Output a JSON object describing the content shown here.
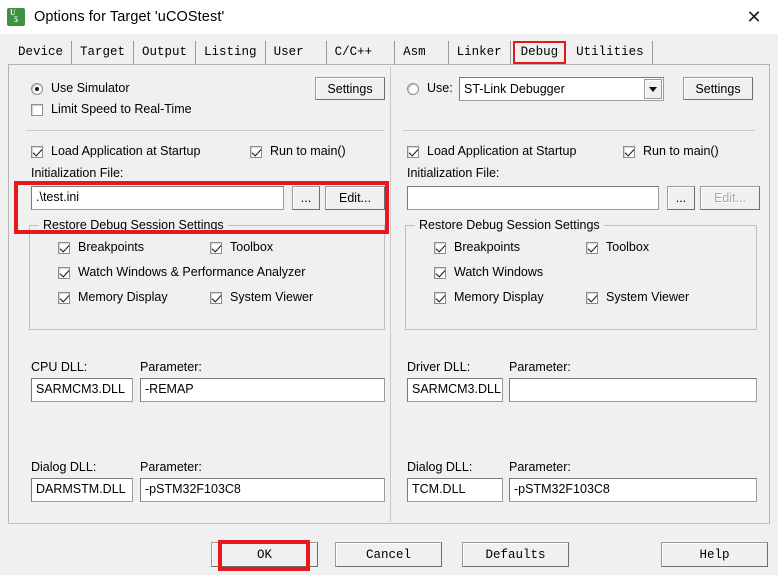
{
  "window": {
    "title": "Options for Target 'uCOStest'",
    "icon": "uvision-logo-icon",
    "icon_glyph_top": "U",
    "icon_glyph_bottom": "5",
    "close_label": "✕"
  },
  "tabs": [
    {
      "label": "Device",
      "active": false
    },
    {
      "label": "Target",
      "active": false
    },
    {
      "label": "Output",
      "active": false
    },
    {
      "label": "Listing",
      "active": false
    },
    {
      "label": "User",
      "active": false
    },
    {
      "label": "C/C++",
      "active": false
    },
    {
      "label": "Asm",
      "active": false
    },
    {
      "label": "Linker",
      "active": false
    },
    {
      "label": "Debug",
      "active": true
    },
    {
      "label": "Utilities",
      "active": false
    }
  ],
  "left_pane": {
    "use_simulator_label": "Use Simulator",
    "use_simulator_checked": true,
    "limit_speed_label": "Limit Speed to Real-Time",
    "limit_speed_checked": false,
    "settings_label": "Settings",
    "load_app_label": "Load Application at Startup",
    "load_app_checked": true,
    "run_to_main_label": "Run to main()",
    "run_to_main_checked": true,
    "init_file_label": "Initialization File:",
    "init_file_value": ".\\test.ini",
    "browse_label": "...",
    "edit_label": "Edit...",
    "edit_disabled": false,
    "restore_group_title": "Restore Debug Session Settings",
    "restore_items": [
      {
        "label": "Breakpoints",
        "checked": true
      },
      {
        "label": "Toolbox",
        "checked": true
      },
      {
        "label": "Watch Windows & Performance Analyzer",
        "checked": true
      },
      {
        "label": "Memory Display",
        "checked": true
      },
      {
        "label": "System Viewer",
        "checked": true
      }
    ],
    "cpu_dll_label": "CPU DLL:",
    "cpu_dll_value": "SARMCM3.DLL",
    "cpu_param_label": "Parameter:",
    "cpu_param_value": "-REMAP",
    "dialog_dll_label": "Dialog DLL:",
    "dialog_dll_value": "DARMSTM.DLL",
    "dialog_param_label": "Parameter:",
    "dialog_param_value": "-pSTM32F103C8"
  },
  "right_pane": {
    "use_label": "Use:",
    "use_checked": false,
    "debugger_value": "ST-Link Debugger",
    "settings_label": "Settings",
    "load_app_label": "Load Application at Startup",
    "load_app_checked": true,
    "run_to_main_label": "Run to main()",
    "run_to_main_checked": true,
    "init_file_label": "Initialization File:",
    "init_file_value": "",
    "browse_label": "...",
    "edit_label": "Edit...",
    "edit_disabled": true,
    "restore_group_title": "Restore Debug Session Settings",
    "restore_items": [
      {
        "label": "Breakpoints",
        "checked": true
      },
      {
        "label": "Toolbox",
        "checked": true
      },
      {
        "label": "Watch Windows",
        "checked": true
      },
      {
        "label": "Memory Display",
        "checked": true
      },
      {
        "label": "System Viewer",
        "checked": true
      }
    ],
    "driver_dll_label": "Driver DLL:",
    "driver_dll_value": "SARMCM3.DLL",
    "driver_param_label": "Parameter:",
    "driver_param_value": "",
    "dialog_dll_label": "Dialog DLL:",
    "dialog_dll_value": "TCM.DLL",
    "dialog_param_label": "Parameter:",
    "dialog_param_value": "-pSTM32F103C8"
  },
  "footer": {
    "ok_label": "OK",
    "cancel_label": "Cancel",
    "defaults_label": "Defaults",
    "help_label": "Help"
  },
  "annotations": {
    "highlight_color": "#e8171b",
    "boxes": [
      {
        "name": "debug-tab-highlight"
      },
      {
        "name": "initialization-file-highlight"
      },
      {
        "name": "ok-button-highlight"
      }
    ]
  }
}
